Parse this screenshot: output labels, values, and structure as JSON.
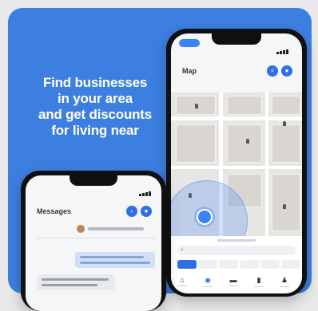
{
  "headline": {
    "line1": "Find businesses",
    "line2": "in your area",
    "line3": "and get discounts",
    "line4": "for living near"
  },
  "map_screen": {
    "title": "Map",
    "filter_link": "",
    "icons": [
      "search-icon",
      "profile-icon",
      "locate-icon",
      "home-icon",
      "map-icon",
      "chat-icon",
      "bookmark-icon",
      "person-icon"
    ]
  },
  "messages_screen": {
    "title": "Messages"
  },
  "colors": {
    "background": "#3d7fe0",
    "accent": "#2f6fe6",
    "outgoing_bubble": "#cfe0f8"
  }
}
